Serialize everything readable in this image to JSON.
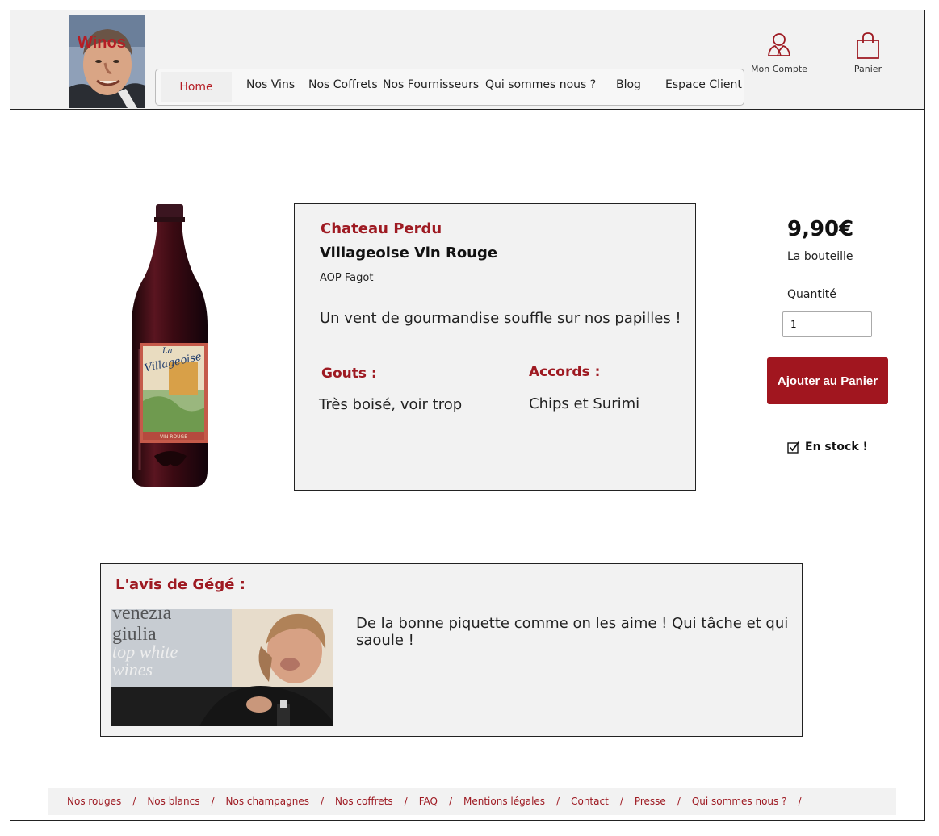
{
  "header": {
    "logo_text": "Winos",
    "nav": [
      {
        "label": "Home"
      },
      {
        "label": "Nos Vins"
      },
      {
        "label": "Nos Coffrets"
      },
      {
        "label": "Nos Fournisseurs"
      },
      {
        "label": "Qui sommes nous ?"
      },
      {
        "label": "Blog"
      },
      {
        "label": "Espace Client"
      }
    ],
    "account_label": "Mon Compte",
    "cart_label": "Panier"
  },
  "product": {
    "producer": "Chateau Perdu",
    "name": "Villageoise Vin Rouge",
    "appellation": "AOP Fagot",
    "tagline": "Un vent de gourmandise souffle sur nos papilles !",
    "gouts_title": "Gouts :",
    "gouts_value": "Très boisé, voir trop",
    "accords_title": "Accords :",
    "accords_value": "Chips et Surimi",
    "bottle_label_brand": "La Villageoise",
    "bottle_label_type": "VIN ROUGE"
  },
  "purchase": {
    "price": "9,90€",
    "unit": "La bouteille",
    "quantity_label": "Quantité",
    "quantity_value": "1",
    "add_button": "Ajouter au Panier",
    "stock_label": "En stock !"
  },
  "review": {
    "title": "L'avis de Gégé :",
    "text": "De la bonne piquette comme on les aime ! Qui tâche et qui saoule !",
    "photo_background_text": [
      "venezia",
      "giulia",
      "top white",
      "wines"
    ]
  },
  "footer": {
    "links": [
      "Nos rouges",
      "Nos blancs",
      "Nos champagnes",
      "Nos coffrets",
      "FAQ",
      "Mentions légales",
      "Contact",
      "Presse",
      "Qui sommes nous ?"
    ]
  },
  "colors": {
    "accent": "#9e1a22",
    "button": "#a1161f",
    "panel": "#f2f2f2"
  }
}
